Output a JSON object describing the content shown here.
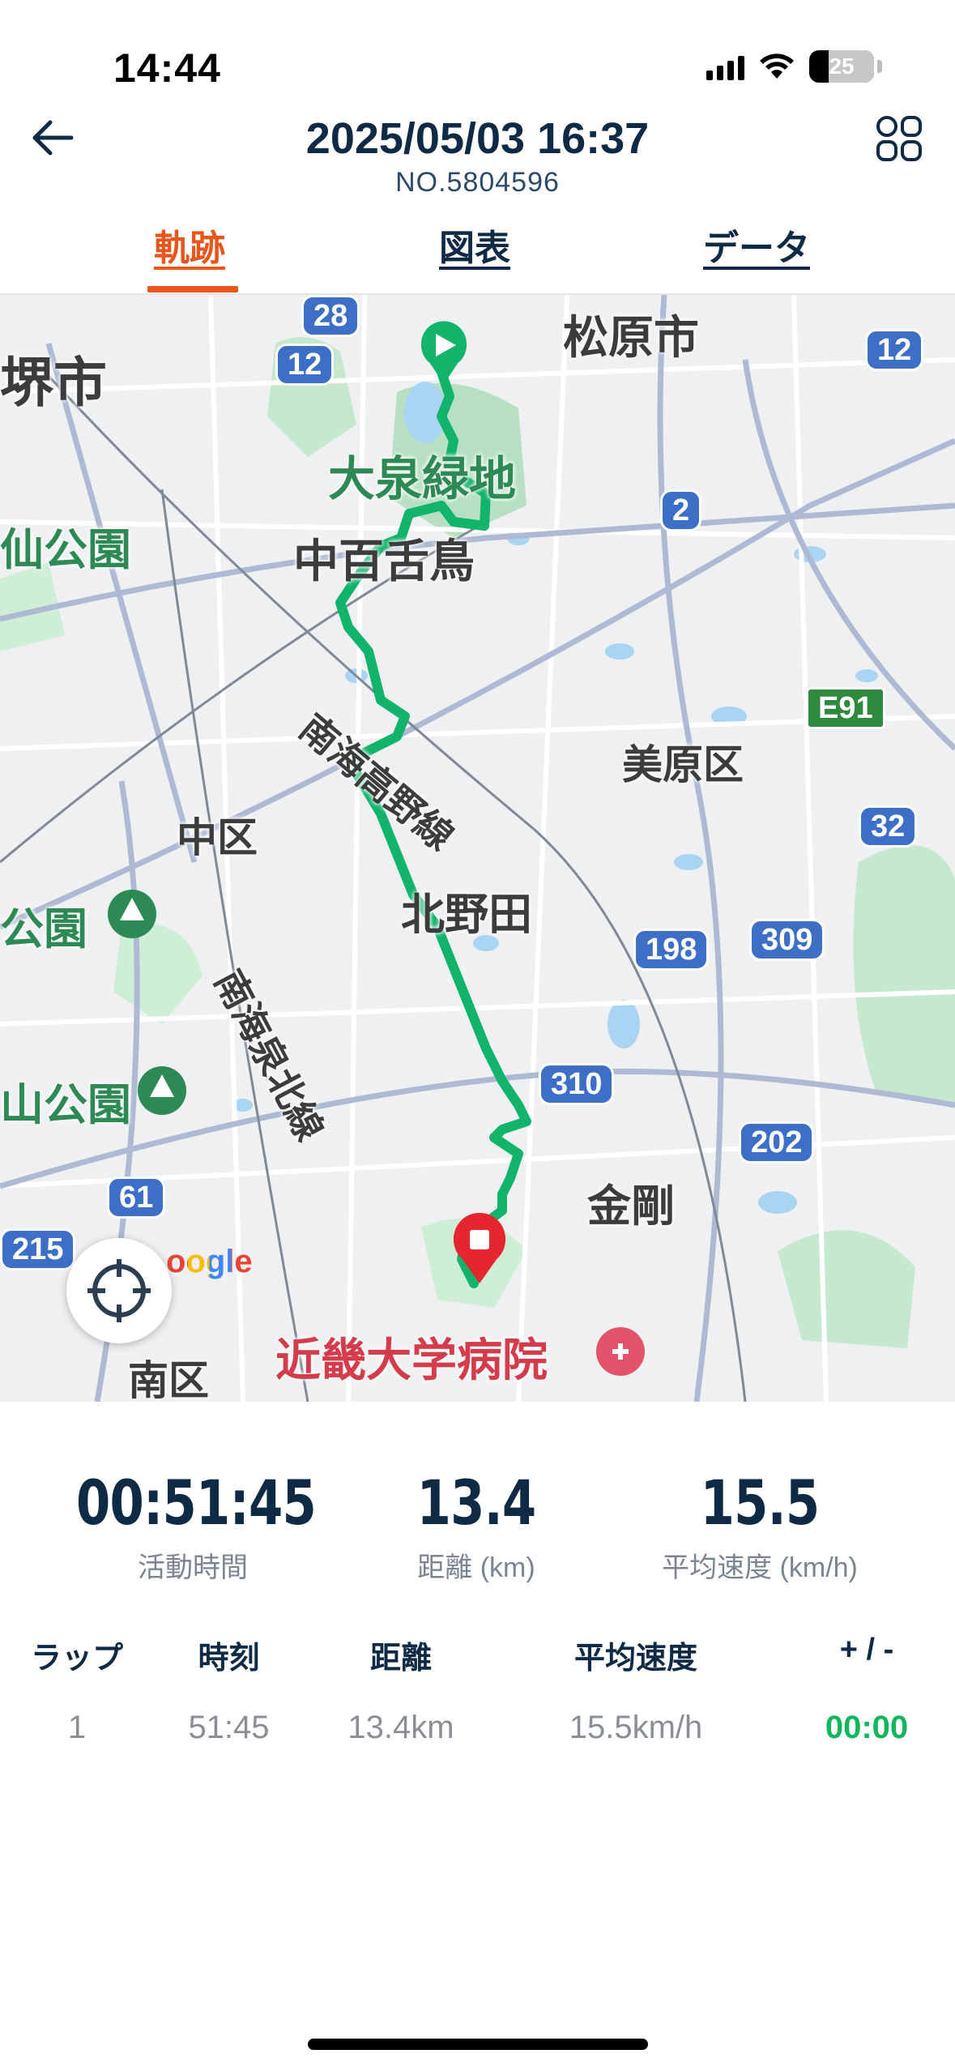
{
  "status_bar": {
    "time": "14:44",
    "battery": "25"
  },
  "header": {
    "title": "2025/05/03 16:37",
    "subtitle": "NO.5804596"
  },
  "tabs": [
    {
      "label": "軌跡",
      "active": true
    },
    {
      "label": "図表",
      "active": false
    },
    {
      "label": "データ",
      "active": false
    }
  ],
  "map": {
    "labels": {
      "matsubara": "松原市",
      "sakai": "堺市",
      "oizumi": "大泉緑地",
      "nakamozu": "中百舌鳥",
      "sen_park": "仙公園",
      "nankai_koya": "南海高野線",
      "mihara": "美原区",
      "naka": "中区",
      "kitanoda": "北野田",
      "park_left": "公園",
      "nankai_senboku": "南海泉北線",
      "park_left2": "山公園",
      "kongo": "金剛",
      "kindai": "近畿大学病院",
      "minami": "南区",
      "google": "oogle"
    },
    "shields": [
      "28",
      "12",
      "12",
      "2",
      "E91",
      "32",
      "198",
      "309",
      "310",
      "202",
      "61",
      "215"
    ],
    "route_color": "#12b36a"
  },
  "stats": [
    {
      "value": "00:51:45",
      "label": "活動時間"
    },
    {
      "value": "13.4",
      "label": "距離 (km)"
    },
    {
      "value": "15.5",
      "label": "平均速度 (km/h)"
    }
  ],
  "laps": {
    "headers": [
      "ラップ",
      "時刻",
      "距離",
      "平均速度",
      "+ / -"
    ],
    "rows": [
      [
        "1",
        "51:45",
        "13.4km",
        "15.5km/h",
        "00:00"
      ]
    ]
  }
}
